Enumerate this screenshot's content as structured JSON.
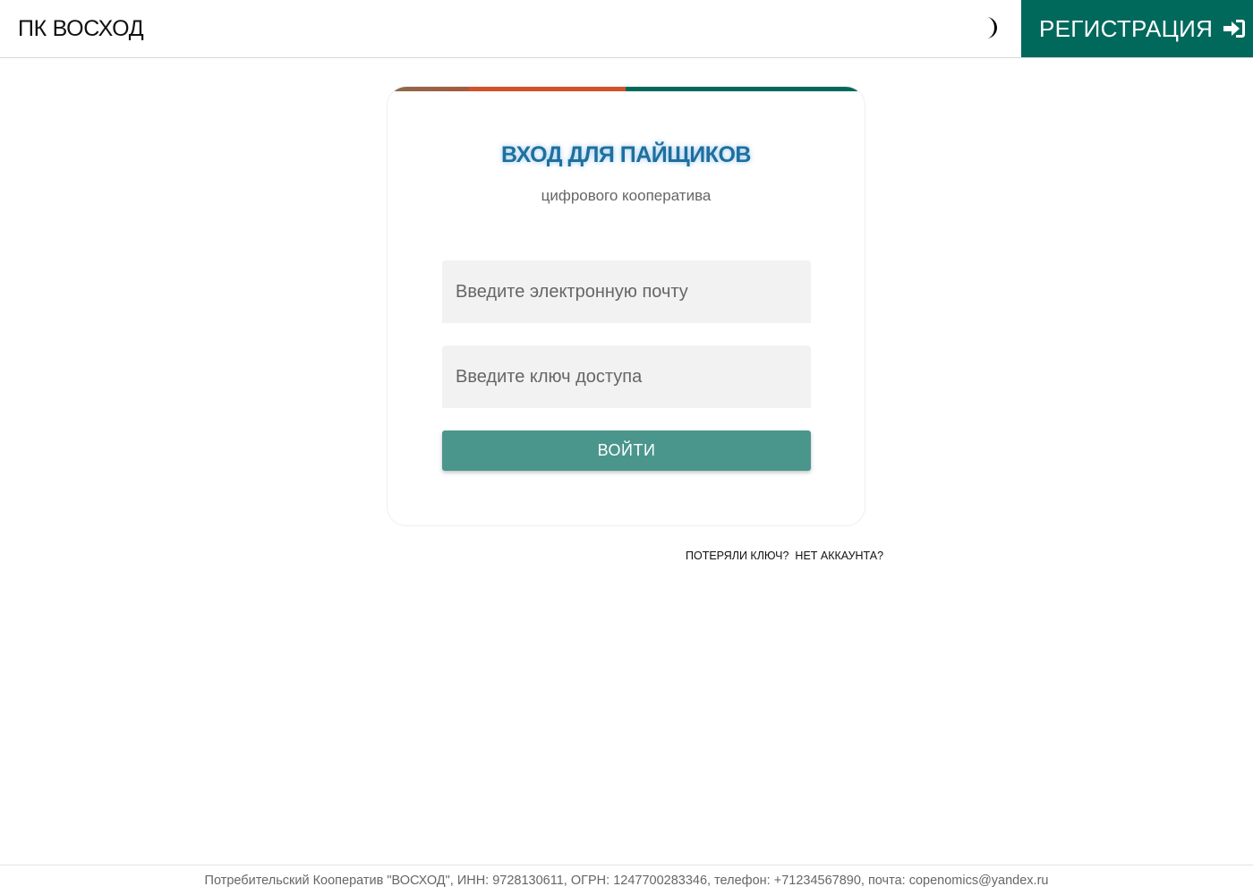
{
  "header": {
    "brand": "ПК ВОСХОД",
    "theme_toggle_icon": "half-moon-icon",
    "register_label": "РЕГИСТРАЦИЯ",
    "register_icon": "sign-in-icon"
  },
  "login_card": {
    "title": "ВХОД ДЛЯ ПАЙЩИКОВ",
    "subtitle": "цифрового кооператива",
    "email_placeholder": "Введите электронную почту",
    "key_placeholder": "Введите ключ доступа",
    "submit_label": "ВОЙТИ",
    "stripe_colors": [
      "#8a6a4e",
      "#d2522a",
      "#00695c"
    ]
  },
  "links": {
    "lost_key": "ПОТЕРЯЛИ КЛЮЧ?",
    "no_account": "НЕТ АККАУНТА?"
  },
  "footer": {
    "text": "Потребительский Кооператив \"ВОСХОД\", ИНН: 9728130611, ОГРН: 1247700283346, телефон: +71234567890, почта: copenomics@yandex.ru"
  },
  "colors": {
    "accent": "#00695c",
    "button": "#4a968c",
    "title": "#1f6f9c"
  }
}
